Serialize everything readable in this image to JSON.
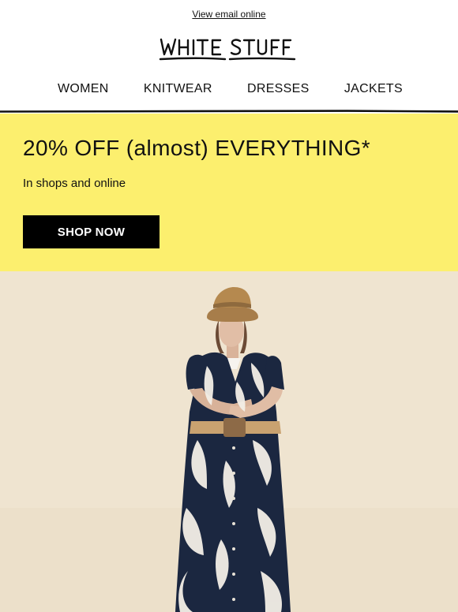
{
  "header": {
    "view_online": "View email online",
    "logo_text": "WHITE STUFF"
  },
  "nav": {
    "items": [
      {
        "label": "WOMEN"
      },
      {
        "label": "KNITWEAR"
      },
      {
        "label": "DRESSES"
      },
      {
        "label": "JACKETS"
      }
    ]
  },
  "promo": {
    "headline": "20% OFF (almost) EVERYTHING*",
    "subtext": "In shops and online",
    "cta": "SHOP NOW",
    "background_color": "#fcef6e"
  },
  "hero": {
    "background_color": "#efe4d0",
    "description": "",
    "icons": [
      "hero-model-image"
    ]
  }
}
